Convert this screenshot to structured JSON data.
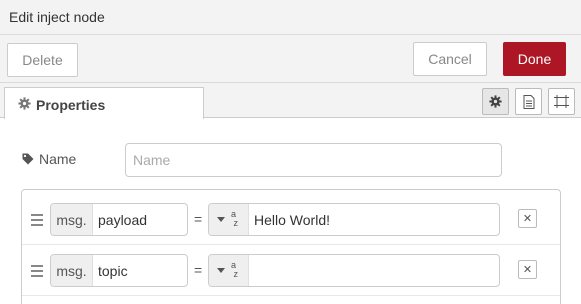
{
  "dialog": {
    "title": "Edit inject node"
  },
  "buttons": {
    "delete": "Delete",
    "cancel": "Cancel",
    "done": "Done"
  },
  "colors": {
    "done_bg": "#ad1625",
    "header_bg": "#f3f3f3"
  },
  "tabs": [
    {
      "label": "Properties",
      "icon": "gear-icon",
      "active": true
    }
  ],
  "tab_icons": [
    "gear-icon",
    "document-icon",
    "frame-icon"
  ],
  "name_field": {
    "label": "Name",
    "icon": "tag-icon",
    "placeholder": "Name",
    "value": ""
  },
  "properties": [
    {
      "type": "msg.",
      "name": "payload",
      "equals": "=",
      "value_type_icon": "az",
      "value": "Hello World!"
    },
    {
      "type": "msg.",
      "name": "topic",
      "equals": "=",
      "value_type_icon": "az",
      "value": ""
    }
  ]
}
